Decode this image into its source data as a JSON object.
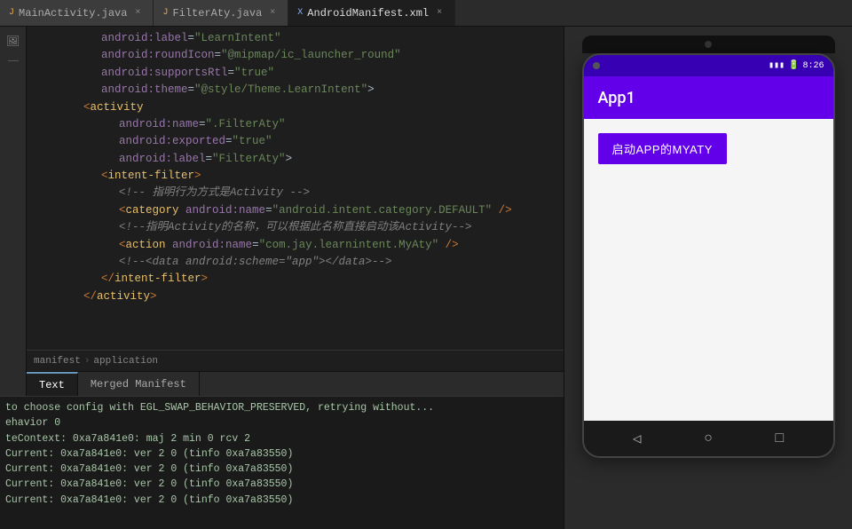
{
  "tabs": [
    {
      "id": "main",
      "label": "MainActivity.java",
      "type": "java",
      "active": false
    },
    {
      "id": "filter",
      "label": "FilterAty.java",
      "type": "java",
      "active": false
    },
    {
      "id": "manifest",
      "label": "AndroidManifest.xml",
      "type": "xml",
      "active": true
    }
  ],
  "code_lines": [
    {
      "num": "",
      "content": "android:label=\"LearnIntent\"",
      "type": "attr_line"
    },
    {
      "num": "",
      "content": "android:roundIcon=\"@mipmap/ic_launcher_round\"",
      "type": "attr_line"
    },
    {
      "num": "",
      "content": "android:supportsRtl=\"true\"",
      "type": "attr_line"
    },
    {
      "num": "",
      "content": "android:theme=\"@style/Theme.LearnIntent\">",
      "type": "attr_line"
    },
    {
      "num": "",
      "content": "<activity",
      "type": "tag_line"
    },
    {
      "num": "",
      "content": "android:name=\".FilterAty\"",
      "type": "attr_line"
    },
    {
      "num": "",
      "content": "android:exported=\"true\"",
      "type": "attr_line"
    },
    {
      "num": "",
      "content": "android:label=\"FilterAty\">",
      "type": "attr_line"
    },
    {
      "num": "",
      "content": "<intent-filter>",
      "type": "tag_line"
    },
    {
      "num": "",
      "content": "<!-- 指明行为方式是Activity -->",
      "type": "comment_line"
    },
    {
      "num": "",
      "content": "<category android:name=\"android.intent.category.DEFAULT\" />",
      "type": "tag_line"
    },
    {
      "num": "",
      "content": "<!--指明Activity的名称，可以根据此名称直接启动该Activity-->",
      "type": "comment_line"
    },
    {
      "num": "",
      "content": "<action android:name=\"com.jay.learnintent.MyAty\" />",
      "type": "tag_line"
    },
    {
      "num": "",
      "content": "<!--<data android:scheme=\"app\"></data>-->",
      "type": "comment_line"
    },
    {
      "num": "",
      "content": "</intent-filter>",
      "type": "close_tag"
    },
    {
      "num": "",
      "content": "",
      "type": "empty"
    },
    {
      "num": "",
      "content": "</activity>",
      "type": "close_tag"
    }
  ],
  "breadcrumb": {
    "items": [
      "manifest",
      "application"
    ]
  },
  "bottom_tabs": [
    {
      "label": "Text",
      "active": true
    },
    {
      "label": "Merged Manifest",
      "active": false
    }
  ],
  "log_lines": [
    "to choose config with EGL_SWAP_BEHAVIOR_PRESERVED, retrying without...",
    "ehavior 0",
    "teContext: 0xa7a841e0: maj 2 min 0 rcv 2",
    "Current: 0xa7a841e0: ver 2 0 (tinfo 0xa7a83550)",
    "Current: 0xa7a841e0: ver 2 0 (tinfo 0xa7a83550)",
    "Current: 0xa7a841e0: ver 2 0 (tinfo 0xa7a83550)",
    "Current: 0xa7a841e0: ver 2 0 (tinfo 0xa7a83550)"
  ],
  "phone": {
    "status_bar": {
      "signal": "📶",
      "time": "8:26"
    },
    "app_title": "App1",
    "button_label": "启动APP的MYATY",
    "nav": {
      "back": "◁",
      "home": "○",
      "recent": "□"
    }
  }
}
